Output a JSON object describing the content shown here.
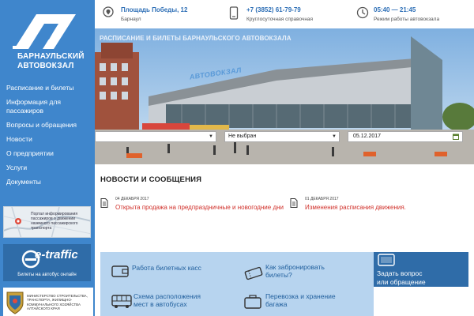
{
  "sidebar": {
    "logo_line1": "БАРНАУЛЬСКИЙ",
    "logo_line2": "АВТОВОКЗАЛ",
    "nav": [
      {
        "label": "Расписание и билеты"
      },
      {
        "label": "Информация для пассажиров"
      },
      {
        "label": "Вопросы и обращения"
      },
      {
        "label": "Новости"
      },
      {
        "label": "О предприятии"
      },
      {
        "label": "Услуги"
      },
      {
        "label": "Документы"
      }
    ],
    "map_banner_text": "Портал информирования пассажиров о движении наземного пассажирского транспорта",
    "etraffic_logo": "e-traffic",
    "etraffic_caption": "Билеты на автобус онлайн",
    "ministry_text": "МИНИСТЕРСТВО СТРОИТЕЛЬСТВА, ТРАНСПОРТА, ЖИЛИЩНО-КОММУНАЛЬНОГО ХОЗЯЙСТВА АЛТАЙСКОГО КРАЯ"
  },
  "header": {
    "address_title": "Площадь Победы, 12",
    "address_sub": "Барнаул",
    "phone_title": "+7 (3852) 61-79-79",
    "phone_sub": "Круглосуточная справочная",
    "hours_title": "05:40 — 21:45",
    "hours_sub": "Режим работы автовокзала"
  },
  "hero": {
    "caption": "РАСПИСАНИЕ И БИЛЕТЫ БАРНАУЛЬСКОГО АВТОВОКЗАЛА",
    "building_sign": "АВТОВОКЗАЛ",
    "from_value": "",
    "to_value": "Не выбран",
    "date_value": "05.12.2017"
  },
  "news": {
    "title": "НОВОСТИ И СООБЩЕНИЯ",
    "items": [
      {
        "date": "04 ДЕКАБРЯ 2017",
        "text": "Открыта продажа на предпраздничные и новогодние дни"
      },
      {
        "date": "01 ДЕКАБРЯ 2017",
        "text": "Изменения расписания движения."
      }
    ]
  },
  "services": {
    "ticket_offices": "Работа билетных касс",
    "how_to_book_1": "Как забронировать",
    "how_to_book_2": "билеты?",
    "seat_map_1": "Схема расположения",
    "seat_map_2": "мест в автобусах",
    "luggage_1": "Перевозка и хранение",
    "luggage_2": "багажа",
    "ask_1": "Задать вопрос",
    "ask_2": "или обращение"
  },
  "colors": {
    "sidebar": "#3f86cc",
    "accent": "#2e6fb6",
    "news_link": "#d0302a",
    "services_bg": "#b7d4ef",
    "ask_bg": "#2f6ca8"
  }
}
